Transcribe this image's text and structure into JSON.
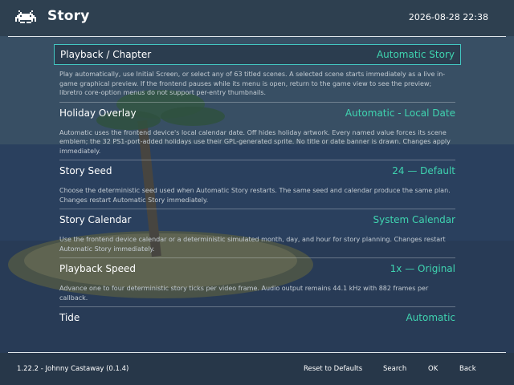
{
  "header": {
    "title": "Story",
    "clock": "2026-08-28 22:38"
  },
  "settings": [
    {
      "label": "Playback / Chapter",
      "value": "Automatic Story",
      "selected": true,
      "description": "Play automatically, use Initial Screen, or select any of 63 titled scenes. A selected scene starts immediately as a live in-game graphical preview. If the frontend pauses while its menu is open, return to the game view to see the preview; libretro core-option menus do not support per-entry thumbnails."
    },
    {
      "label": "Holiday Overlay",
      "value": "Automatic - Local Date",
      "description": "Automatic uses the frontend device's local calendar date. Off hides holiday artwork. Every named value forces its scene emblem; the 32 PS1-port-added holidays use their GPL-generated sprite. No title or date banner is drawn. Changes apply immediately."
    },
    {
      "label": "Story Seed",
      "value": "24 — Default",
      "description": "Choose the deterministic seed used when Automatic Story restarts. The same seed and calendar produce the same plan. Changes restart Automatic Story immediately."
    },
    {
      "label": "Story Calendar",
      "value": "System Calendar",
      "description": "Use the frontend device calendar or a deterministic simulated month, day, and hour for story planning. Changes restart Automatic Story immediately."
    },
    {
      "label": "Playback Speed",
      "value": "1x — Original",
      "description": "Advance one to four deterministic story ticks per video frame. Audio output remains 44.1 kHz with 882 frames per callback."
    },
    {
      "label": "Tide",
      "value": "Automatic",
      "description": ""
    }
  ],
  "footer": {
    "version": "1.22.2 - Johnny Castaway (0.1.4)",
    "reset_label": "Reset to Defaults",
    "search_label": "Search",
    "ok_label": "OK",
    "back_label": "Back"
  },
  "colors": {
    "accent": "#43c7c2",
    "value": "#3fd4b0",
    "text": "#ffffff",
    "description": "#c3cbd2"
  }
}
